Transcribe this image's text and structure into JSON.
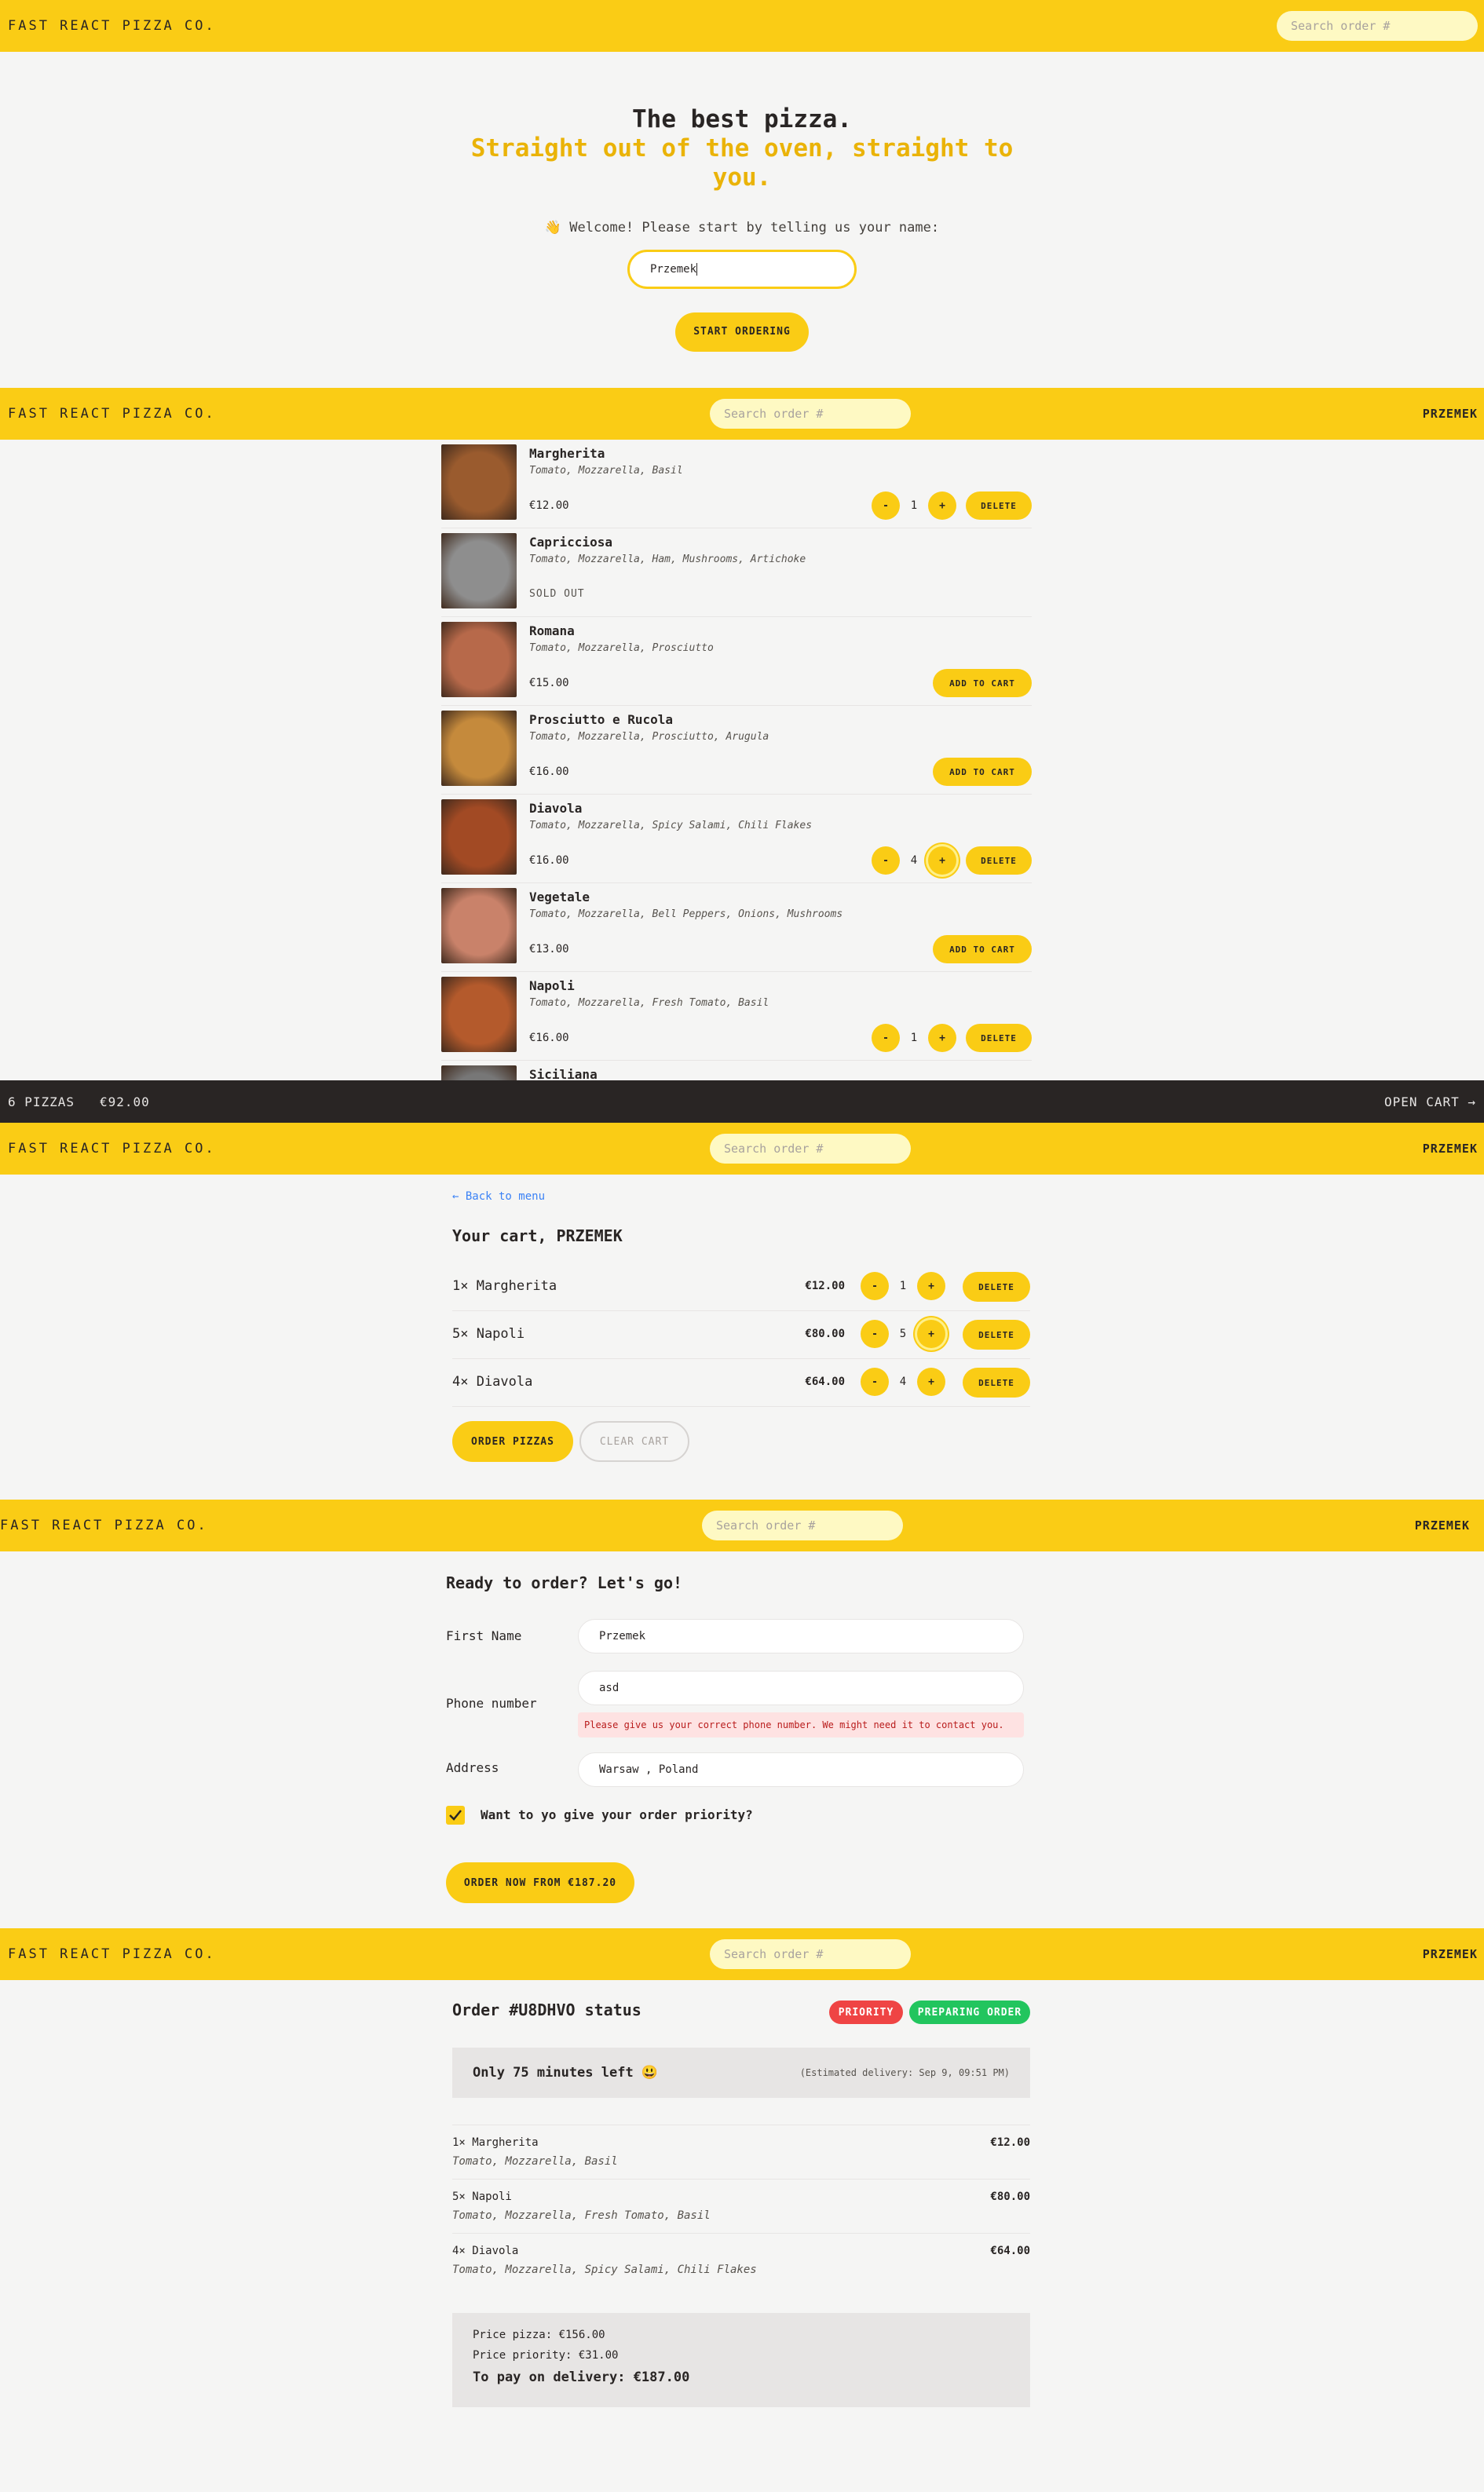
{
  "header": {
    "logo": "FAST REACT PIZZA CO.",
    "search_placeholder": "Search order #",
    "user": "PRZEMEK"
  },
  "home": {
    "title": "The best pizza.",
    "subtitle": "Straight out of the oven, straight to you.",
    "welcome": "👋 Welcome! Please start by telling us your name:",
    "name_value": "Przemek",
    "start_button": "START ORDERING"
  },
  "menu": {
    "sold_out_label": "SOLD OUT",
    "add_to_cart_label": "ADD TO CART",
    "delete_label": "DELETE",
    "minus": "-",
    "plus": "+",
    "pizzas": [
      {
        "name": "Margherita",
        "ingredients": "Tomato, Mozzarella, Basil",
        "price": "€12.00",
        "qty": "1",
        "state": "in_cart",
        "img_color": "#9a5b2e"
      },
      {
        "name": "Capricciosa",
        "ingredients": "Tomato, Mozzarella, Ham, Mushrooms, Artichoke",
        "price": "",
        "qty": "",
        "state": "sold_out",
        "img_color": "#8e8e8e"
      },
      {
        "name": "Romana",
        "ingredients": "Tomato, Mozzarella, Prosciutto",
        "price": "€15.00",
        "qty": "",
        "state": "available",
        "img_color": "#b7694a"
      },
      {
        "name": "Prosciutto e Rucola",
        "ingredients": "Tomato, Mozzarella, Prosciutto, Arugula",
        "price": "€16.00",
        "qty": "",
        "state": "available",
        "img_color": "#c58a3c"
      },
      {
        "name": "Diavola",
        "ingredients": "Tomato, Mozzarella, Spicy Salami, Chili Flakes",
        "price": "€16.00",
        "qty": "4",
        "state": "in_cart",
        "img_color": "#a24a24"
      },
      {
        "name": "Vegetale",
        "ingredients": "Tomato, Mozzarella, Bell Peppers, Onions, Mushrooms",
        "price": "€13.00",
        "qty": "",
        "state": "available",
        "img_color": "#c9826a"
      },
      {
        "name": "Napoli",
        "ingredients": "Tomato, Mozzarella, Fresh Tomato, Basil",
        "price": "€16.00",
        "qty": "1",
        "state": "in_cart",
        "img_color": "#b45a2c"
      },
      {
        "name": "Siciliana",
        "ingredients": "",
        "price": "",
        "qty": "",
        "state": "partial",
        "img_color": "#777777"
      }
    ]
  },
  "cart_bar": {
    "summary": "6 PIZZAS   €92.00",
    "open_cart": "OPEN CART →"
  },
  "cart": {
    "back": "← Back to menu",
    "title": "Your cart, PRZEMEK",
    "items": [
      {
        "name": "1× Margherita",
        "price": "€12.00",
        "qty": "1"
      },
      {
        "name": "5× Napoli",
        "price": "€80.00",
        "qty": "5"
      },
      {
        "name": "4× Diavola",
        "price": "€64.00",
        "qty": "4"
      }
    ],
    "delete_label": "DELETE",
    "order_button": "ORDER PIZZAS",
    "clear_button": "CLEAR CART"
  },
  "order_form": {
    "title": "Ready to order? Let's go!",
    "first_name_label": "First Name",
    "first_name_value": "Przemek",
    "phone_label": "Phone number",
    "phone_value": "asd",
    "phone_error": "Please give us your correct phone number. We might need it to contact you.",
    "address_label": "Address",
    "address_value": "Warsaw , Poland",
    "priority_label": "Want to yo give your order priority?",
    "submit": "ORDER NOW FROM €187.20"
  },
  "order_status": {
    "title": "Order #U8DHVO status",
    "badge_priority": "PRIORITY",
    "badge_status": "PREPARING ORDER",
    "eta_left": "Only 75 minutes left 😃",
    "eta_right": "(Estimated delivery: Sep 9, 09:51 PM)",
    "items": [
      {
        "name": "1× Margherita",
        "ingredients": "Tomato, Mozzarella, Basil",
        "price": "€12.00"
      },
      {
        "name": "5× Napoli",
        "ingredients": "Tomato, Mozzarella, Fresh Tomato, Basil",
        "price": "€80.00"
      },
      {
        "name": "4× Diavola",
        "ingredients": "Tomato, Mozzarella, Spicy Salami, Chili Flakes",
        "price": "€64.00"
      }
    ],
    "price_pizza": "Price pizza: €156.00",
    "price_priority": "Price priority: €31.00",
    "to_pay": "To pay on delivery: €187.00"
  },
  "colors": {
    "brand": "#facc15",
    "brand_light": "#fef9c3",
    "dark": "#292524",
    "priority": "#ef4444",
    "preparing": "#22c55e"
  }
}
